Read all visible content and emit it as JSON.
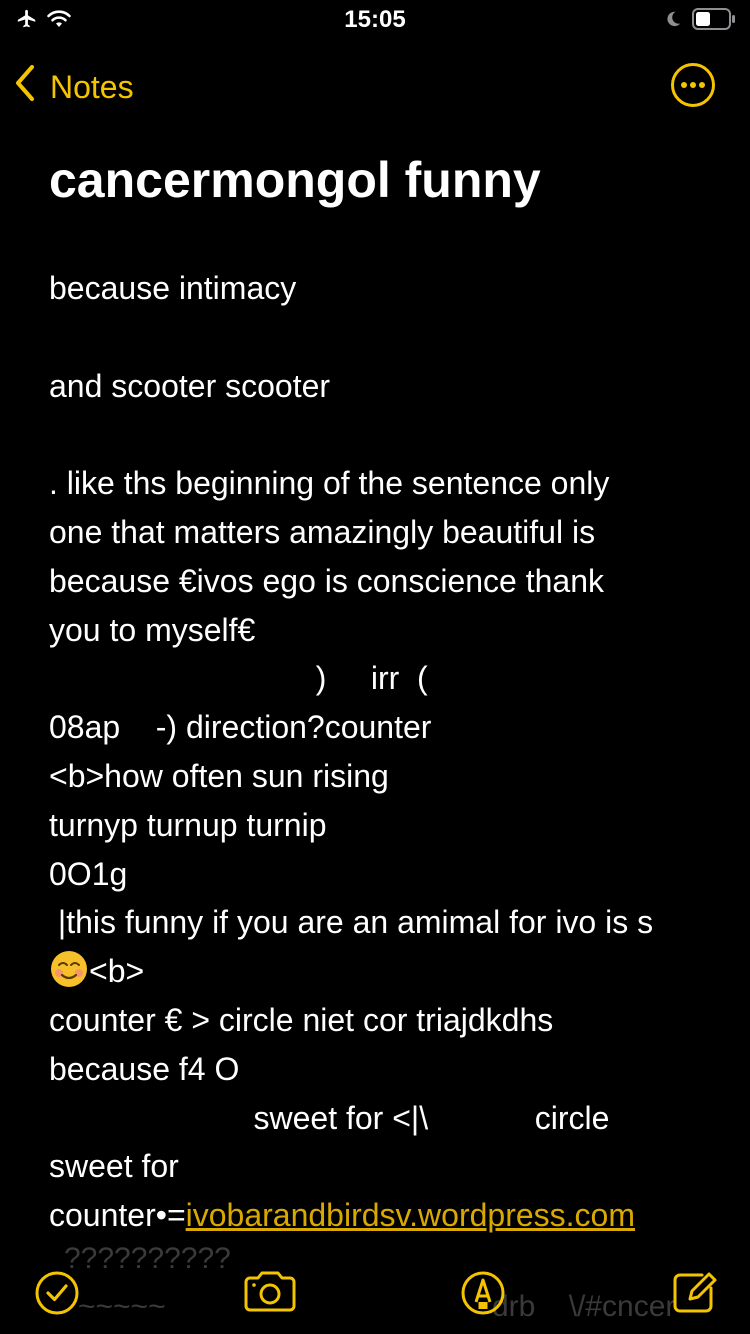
{
  "status_bar": {
    "time": "15:05",
    "icons": [
      "airplane-icon",
      "wifi-icon",
      "moon-icon",
      "battery-icon"
    ]
  },
  "nav": {
    "back_label": "Notes",
    "more_icon": "ellipsis-circle-icon"
  },
  "note": {
    "title": "cancermongol funny",
    "lines": [
      "because intimacy",
      "",
      "and scooter scooter",
      "",
      ". like ths beginning of the sentence only",
      "one that matters amazingly beautiful is",
      "because €ivos ego is conscience thank",
      "you to myself€",
      "                              )     irr  (",
      "08ap    -) direction?counter",
      "<b>how often sun rising",
      "turnyp turnup turnip",
      "0O1g",
      " |this funny if you are an amimal for ivo is s",
      "<b>",
      "counter € > circle niet cor triajdkdhs",
      "because f4 O",
      "                       sweet for <|\\            circle",
      "sweet for",
      "counter•="
    ],
    "link": "ivobarandbirdsv.wordpress.com",
    "faded_lines": [
      "??????????",
      "~~~~~",
      "drb    \\/#cncer"
    ]
  },
  "toolbar": {
    "icons": [
      "checklist-icon",
      "camera-icon",
      "markup-icon",
      "compose-icon"
    ]
  },
  "colors": {
    "background": "#000000",
    "text": "#ffffff",
    "accent": "#f5c400",
    "link": "#d9a900"
  }
}
